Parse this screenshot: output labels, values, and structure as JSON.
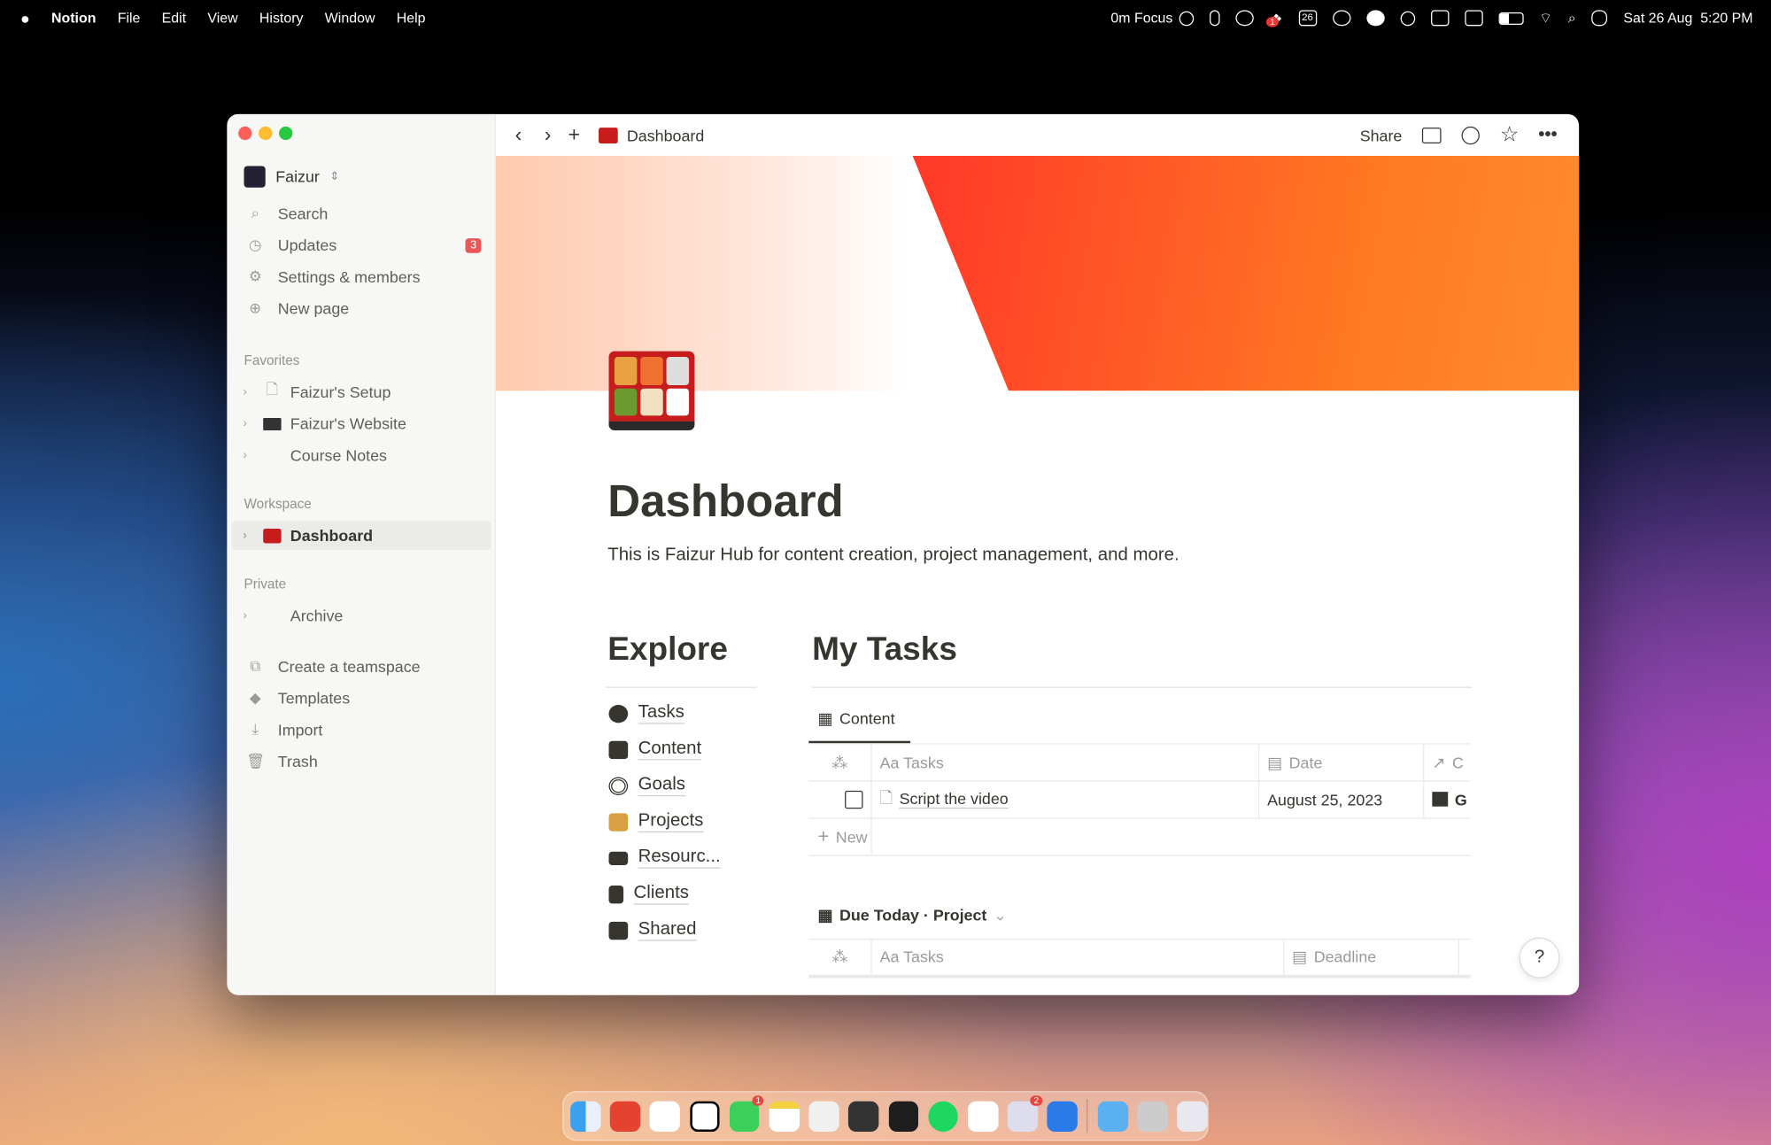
{
  "menubar": {
    "app": "Notion",
    "menus": [
      "File",
      "Edit",
      "View",
      "History",
      "Window",
      "Help"
    ],
    "focus": "0m Focus",
    "calendar_day": "26",
    "datetime": "Sat 26 Aug  5:20 PM",
    "dropbox_badge": "1"
  },
  "sidebar": {
    "workspace": "Faizur",
    "items": [
      {
        "label": "Search",
        "icon": "search-icon"
      },
      {
        "label": "Updates",
        "icon": "clock-icon",
        "badge": "3"
      },
      {
        "label": "Settings & members",
        "icon": "gear-icon"
      },
      {
        "label": "New page",
        "icon": "plus-circle-icon"
      }
    ],
    "favorites_header": "Favorites",
    "favorites": [
      "Faizur's Setup",
      "Faizur's Website",
      "Course Notes"
    ],
    "workspace_header": "Workspace",
    "workspace_items": [
      "Dashboard"
    ],
    "private_header": "Private",
    "private_items": [
      "Archive"
    ],
    "bottom": [
      "Create a teamspace",
      "Templates",
      "Import",
      "Trash"
    ]
  },
  "topbar": {
    "breadcrumb": "Dashboard",
    "share": "Share"
  },
  "page": {
    "title": "Dashboard",
    "description": "This is Faizur Hub for content creation, project management, and more.",
    "explore": {
      "heading": "Explore",
      "items": [
        "Tasks",
        "Content",
        "Goals",
        "Projects",
        "Resourc...",
        "Clients",
        "Shared"
      ]
    },
    "my_tasks": {
      "heading": "My Tasks",
      "tab": "Content",
      "columns": [
        "Aa Tasks",
        "Date",
        "C"
      ],
      "rows": [
        {
          "task": "Script the video",
          "date": "August 25, 2023",
          "extra": "G"
        }
      ],
      "new_label": "New",
      "view2": "Due Today · Project",
      "columns2": [
        "Aa Tasks",
        "Deadline"
      ]
    }
  },
  "help": "?",
  "dock": {
    "messages_badge": "1",
    "preview_badge": "2"
  },
  "colors": {
    "sidebar_bg": "#f7f7f5",
    "badge": "#eb5757",
    "text": "#37352f"
  }
}
